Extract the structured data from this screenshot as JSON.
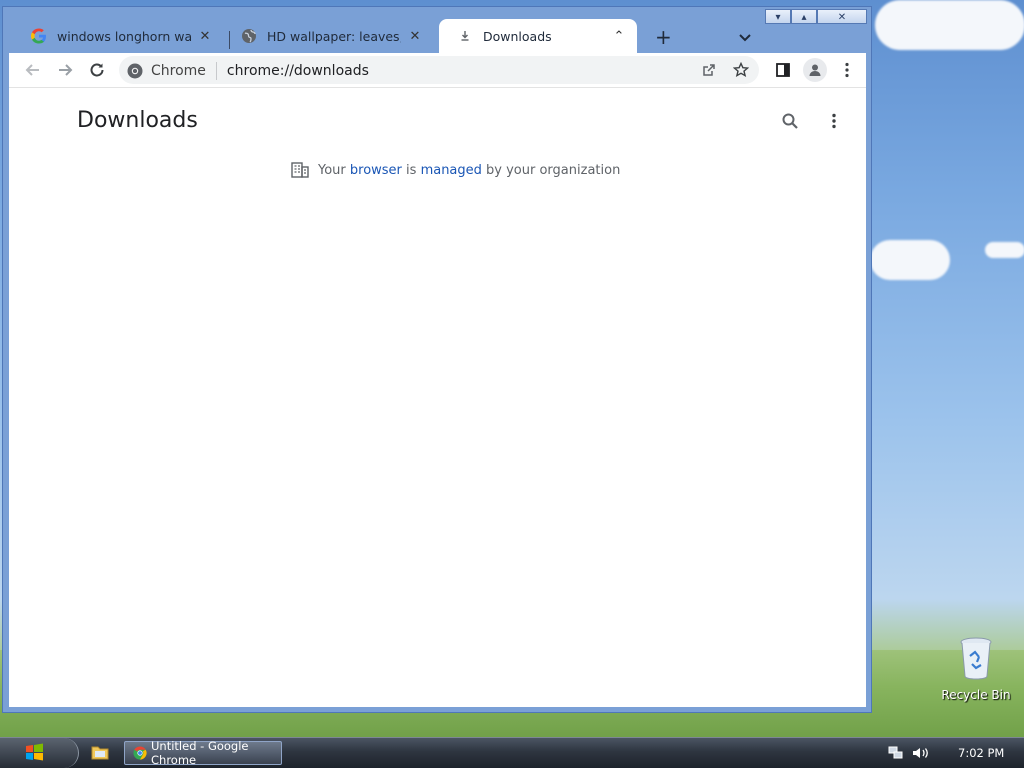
{
  "browser": {
    "tabs": [
      {
        "title": "windows longhorn wallpaper",
        "icon": "google-icon",
        "active": false
      },
      {
        "title": "HD wallpaper: leaves, longhorn",
        "icon": "globe-icon",
        "active": false
      },
      {
        "title": "Downloads",
        "icon": "download-icon",
        "active": true
      }
    ],
    "new_tab_label": "+",
    "caption": {
      "minimize": "▾",
      "restore": "▴",
      "close": "✕"
    },
    "omnibox": {
      "site_label": "Chrome",
      "url": "chrome://downloads"
    }
  },
  "page": {
    "title": "Downloads",
    "managed_notice": {
      "prefix": "Your ",
      "browser_link": "browser",
      "middle": " is ",
      "managed_link": "managed",
      "suffix": " by your organization"
    }
  },
  "desktop": {
    "icons": [
      {
        "label": "Recycle Bin",
        "icon": "recycle-bin-icon"
      }
    ]
  },
  "taskbar": {
    "task_label": "Untitled - Google Chrome",
    "clock": "7:02 PM"
  },
  "colors": {
    "link": "#1a56b5",
    "window_frame": "#7aa0d6",
    "taskbar": "#2e3540"
  }
}
